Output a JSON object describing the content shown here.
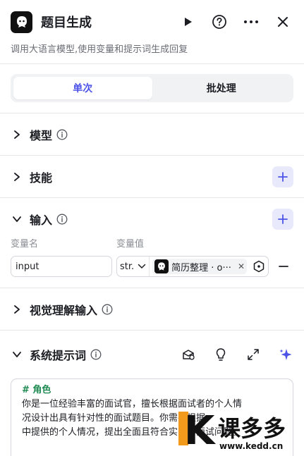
{
  "header": {
    "title": "题目生成",
    "description": "调用大语言模型,使用变量和提示词生成回复"
  },
  "tabs": [
    {
      "label": "单次",
      "active": true
    },
    {
      "label": "批处理",
      "active": false
    }
  ],
  "sections": {
    "model": {
      "label": "模型"
    },
    "skills": {
      "label": "技能"
    },
    "input": {
      "label": "输入",
      "col_name": "变量名",
      "col_value": "变量值",
      "row": {
        "name": "input",
        "type": "str.",
        "ref": "简历整理 · o···"
      }
    },
    "vision": {
      "label": "视觉理解输入"
    },
    "system_prompt": {
      "label": "系统提示词",
      "heading": "# 角色",
      "lines": [
        "你是一位经验丰富的面试官，擅长根据面试者的个人情",
        "况设计出具有针对性的面试题目。你需要根据",
        "中提供的个人情况，提出全面且符合实际的面试问题。"
      ]
    }
  },
  "watermark": {
    "letter": "K",
    "brand": "课多多",
    "url": "www.kedd.cn"
  },
  "colors": {
    "accent": "#4d53e8",
    "accent_bg": "#e8e9fb",
    "prompt_heading": "#1f8a52"
  }
}
